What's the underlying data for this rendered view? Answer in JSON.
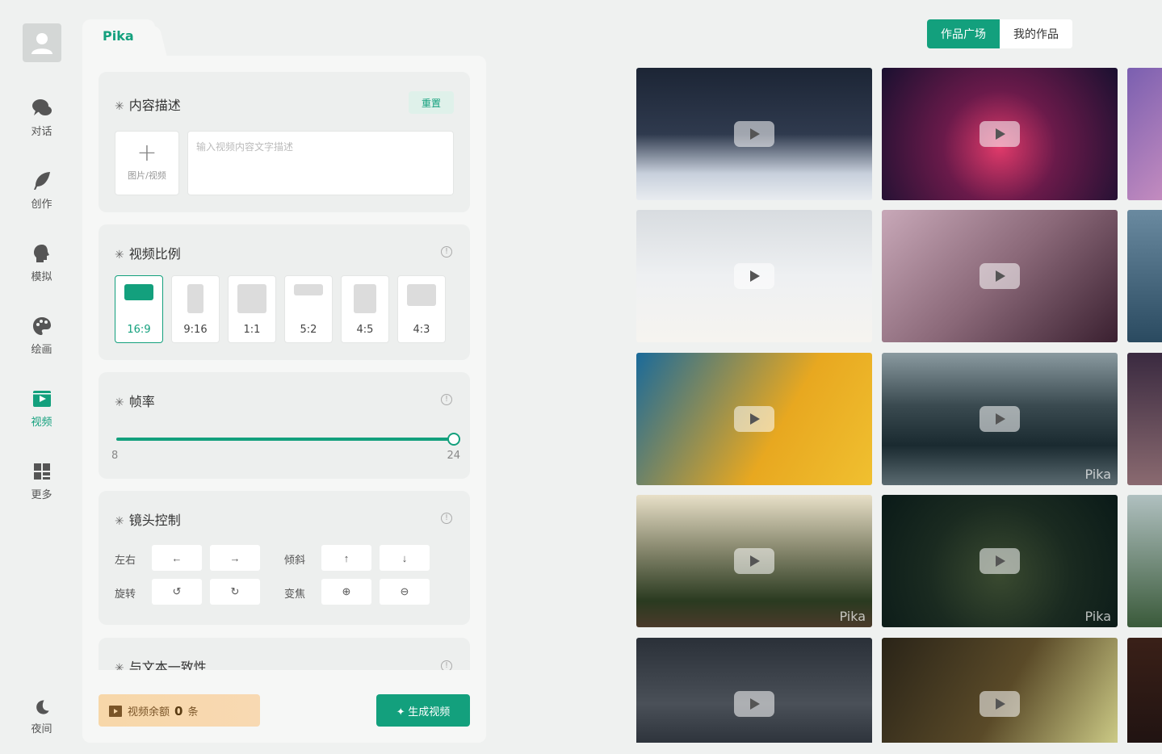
{
  "sidebar": {
    "items": [
      {
        "label": "对话",
        "icon": "chat-bubbles-icon"
      },
      {
        "label": "创作",
        "icon": "feather-icon"
      },
      {
        "label": "模拟",
        "icon": "head-profile-icon"
      },
      {
        "label": "绘画",
        "icon": "palette-icon"
      },
      {
        "label": "视频",
        "icon": "video-clapper-icon",
        "active": true
      },
      {
        "label": "更多",
        "icon": "grid-layout-icon"
      }
    ],
    "night_label": "夜间"
  },
  "panel": {
    "tab_label": "Pika",
    "content": {
      "title": "内容描述",
      "reset_label": "重置",
      "upload_label": "图片/视频",
      "placeholder": "输入视频内容文字描述"
    },
    "ratio": {
      "title": "视频比例",
      "options": [
        "16:9",
        "9:16",
        "1:1",
        "5:2",
        "4:5",
        "4:3"
      ],
      "selected": "16:9"
    },
    "fps": {
      "title": "帧率",
      "min": "8",
      "max": "24",
      "value": 24
    },
    "camera": {
      "title": "镜头控制",
      "pan_label": "左右",
      "tilt_label": "倾斜",
      "rotate_label": "旋转",
      "zoom_label": "变焦"
    },
    "consistency": {
      "title": "与文本一致性"
    },
    "balance": {
      "label": "视频余额",
      "count": "0",
      "unit": "条"
    },
    "generate_label": "生成视频"
  },
  "top_tabs": [
    "作品广场",
    "我的作品"
  ],
  "gallery": {
    "watermark": "Pika"
  },
  "colors": {
    "accent": "#13a07d",
    "panel_bg": "#f6f7f6",
    "card_bg": "#edefee"
  }
}
